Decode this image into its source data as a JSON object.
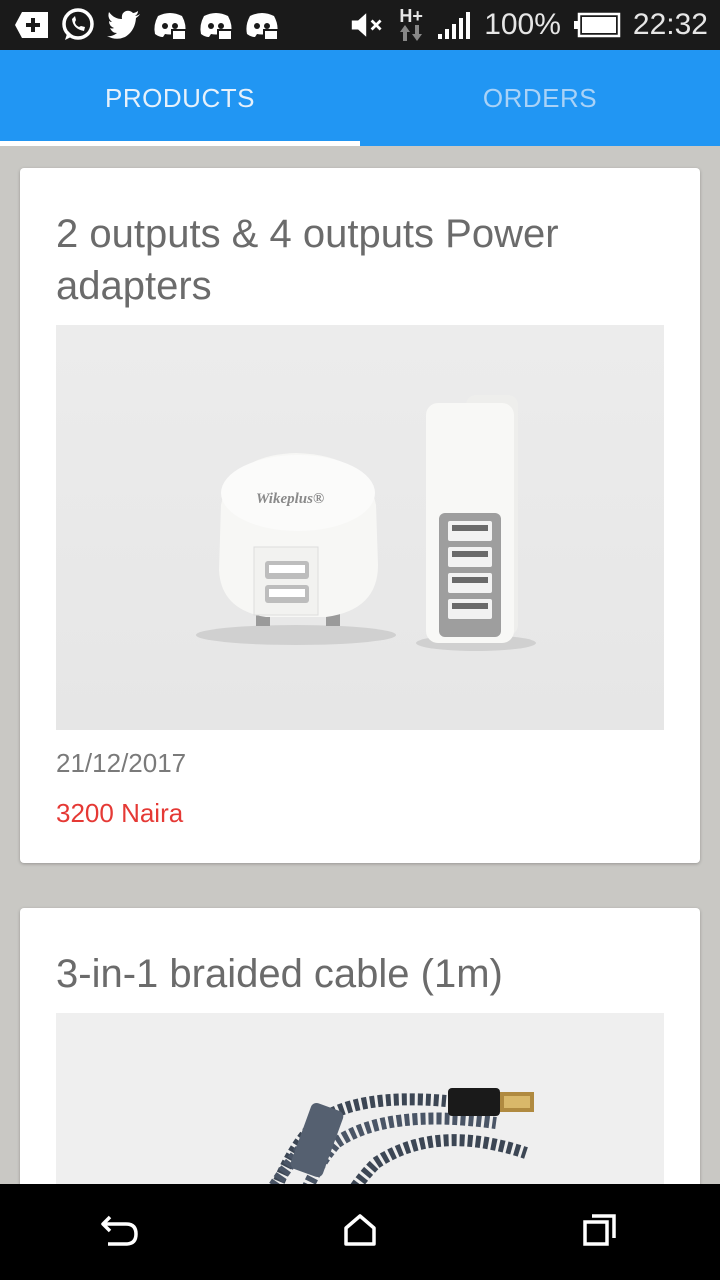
{
  "status_bar": {
    "notification_icons": [
      "add-box-icon",
      "whatsapp-icon",
      "twitter-icon",
      "discord-icon",
      "discord-icon",
      "discord-icon"
    ],
    "mute_icon": "mute-icon",
    "network_type": "H+",
    "battery_percent": "100%",
    "time": "22:32"
  },
  "tabs": [
    {
      "label": "PRODUCTS",
      "active": true
    },
    {
      "label": "ORDERS",
      "active": false
    }
  ],
  "products": [
    {
      "title": "2 outputs & 4 outputs Power adapters",
      "date": "21/12/2017",
      "price": "3200 Naira",
      "image_brand_text": "Wikeplus®"
    },
    {
      "title": "3-in-1 braided cable (1m)"
    }
  ],
  "navbar": {
    "back": "back-icon",
    "home": "home-icon",
    "recents": "recents-icon"
  },
  "colors": {
    "tab_bar": "#2196f3",
    "price": "#e53935",
    "background": "#c9c8c4"
  }
}
